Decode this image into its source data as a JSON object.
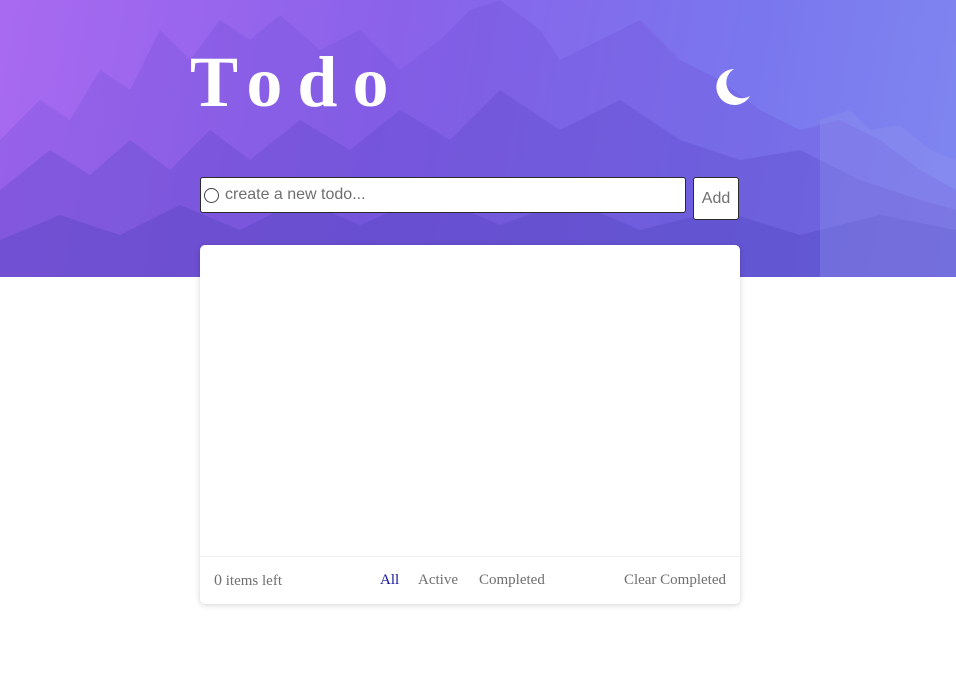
{
  "header": {
    "title": "Todo",
    "theme_toggle_icon": "moon-icon"
  },
  "new_todo": {
    "placeholder": "create a new todo...",
    "value": "",
    "add_label": "Add"
  },
  "todos": [],
  "footer": {
    "items_left_count": "0",
    "items_left_label": "items left",
    "filters": [
      {
        "label": "All",
        "active": true
      },
      {
        "label": "Active",
        "active": false
      },
      {
        "label": "Completed",
        "active": false
      }
    ],
    "clear_label": "Clear Completed"
  },
  "colors": {
    "hero_gradient_start": "#a86af0",
    "hero_gradient_end": "#7f86f0",
    "active_filter": "#1515a0",
    "muted_text": "#6f6f6f"
  }
}
